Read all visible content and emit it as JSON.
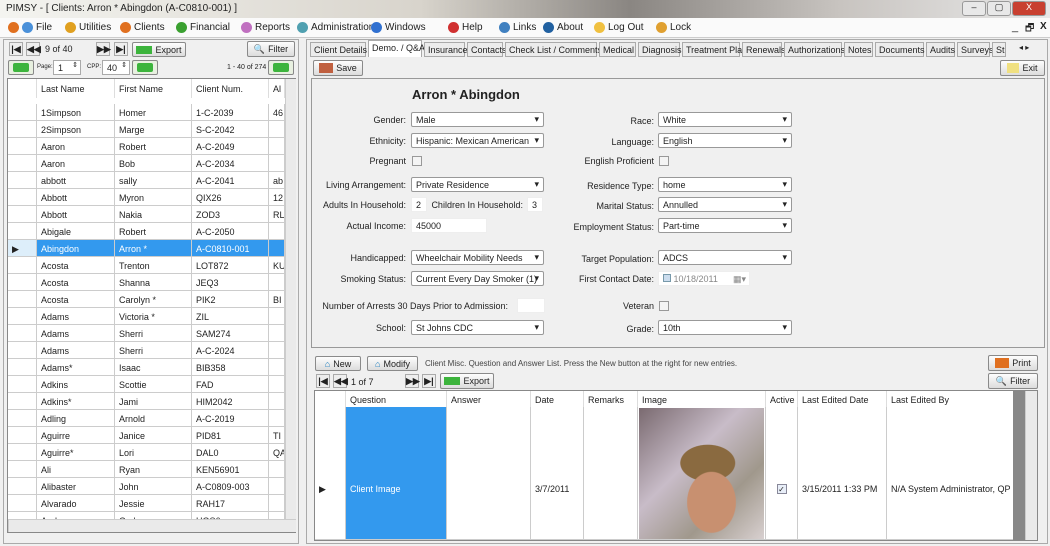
{
  "window": {
    "title": "PIMSY - [ Clients:  Arron * Abingdon (A-C0810-001) ]",
    "min": "–",
    "max": "▢",
    "close": "X"
  },
  "menu": [
    {
      "label": "File",
      "color": "#4a90d9"
    },
    {
      "label": "Utilities",
      "color": "#e0a020"
    },
    {
      "label": "Clients",
      "color": "#e07020"
    },
    {
      "label": "Financial",
      "color": "#3aa030"
    },
    {
      "label": "Reports",
      "color": "#c070c0"
    },
    {
      "label": "Administration",
      "color": "#50a0b0"
    },
    {
      "label": "Windows",
      "color": "#3070d0"
    },
    {
      "label": "Help",
      "color": "#d03030"
    },
    {
      "label": "Links",
      "color": "#4080c0"
    },
    {
      "label": "About",
      "color": "#2060a0"
    },
    {
      "label": "Log Out",
      "color": "#f0c040"
    },
    {
      "label": "Lock",
      "color": "#e0a030"
    }
  ],
  "menu_right": {
    "min": "_",
    "restore": "🗗",
    "close": "X"
  },
  "list": {
    "position": "9 of  40",
    "export": "Export",
    "filter": "Filter",
    "page_label": "Page:",
    "page": "1",
    "cpp_label": "CPP:",
    "cpp": "40",
    "range": "1 - 40 of 274",
    "columns": [
      "Last Name",
      "First Name",
      "Client Num.",
      "Al"
    ],
    "rows": [
      [
        "1Simpson",
        "Homer",
        "1-C-2039",
        "46"
      ],
      [
        "2Simpson",
        "Marge",
        "S-C-2042",
        ""
      ],
      [
        "Aaron",
        "Robert",
        "A-C-2049",
        ""
      ],
      [
        "Aaron",
        "Bob",
        "A-C-2034",
        ""
      ],
      [
        "abbott",
        "sally",
        "A-C-2041",
        "ab"
      ],
      [
        "Abbott",
        "Myron",
        "QIX26",
        "12"
      ],
      [
        "Abbott",
        "Nakia",
        "ZOD3",
        "RL"
      ],
      [
        "Abigale",
        "Robert",
        "A-C-2050",
        ""
      ],
      [
        "Abingdon",
        "Arron *",
        "A-C0810-001",
        ""
      ],
      [
        "Acosta",
        "Trenton",
        "LOT872",
        "KU"
      ],
      [
        "Acosta",
        "Shanna",
        "JEQ3",
        ""
      ],
      [
        "Acosta",
        "Carolyn *",
        "PIK2",
        "BI"
      ],
      [
        "Adams",
        "Victoria *",
        "ZIL",
        ""
      ],
      [
        "Adams",
        "Sherri",
        "SAM274",
        ""
      ],
      [
        "Adams",
        "Sherri",
        "A-C-2024",
        ""
      ],
      [
        "Adams*",
        "Isaac",
        "BIB358",
        ""
      ],
      [
        "Adkins",
        "Scottie",
        "FAD",
        ""
      ],
      [
        "Adkins*",
        "Jami",
        "HIM2042",
        ""
      ],
      [
        "Adling",
        "Arnold",
        "A-C-2019",
        ""
      ],
      [
        "Aguirre",
        "Janice",
        "PID81",
        "TI"
      ],
      [
        "Aguirre*",
        "Lori",
        "DAL0",
        "QA"
      ],
      [
        "Ali",
        "Ryan",
        "KEN56901",
        ""
      ],
      [
        "Alibaster",
        "John",
        "A-C0809-003",
        ""
      ],
      [
        "Alvarado",
        "Jessie",
        "RAH17",
        ""
      ],
      [
        "Andersen",
        "Cody",
        "HOS6",
        ""
      ]
    ],
    "selected_index": 8
  },
  "tabs": [
    "Client Details",
    "Demo. / Q&A",
    "Insurance",
    "Contacts",
    "Check List / Comments",
    "Medical",
    "Diagnosis",
    "Treatment Plan",
    "Renewals",
    "Authorizations",
    "Notes",
    "Documents",
    "Audits",
    "Surveys",
    "St"
  ],
  "active_tab": 1,
  "toolbar": {
    "save": "Save",
    "exit": "Exit"
  },
  "form": {
    "client_name": "Arron * Abingdon",
    "gender_label": "Gender:",
    "gender": "Male",
    "ethnicity_label": "Ethnicity:",
    "ethnicity": "Hispanic:  Mexican American",
    "pregnant_label": "Pregnant",
    "pregnant": false,
    "living_label": "Living Arrangement:",
    "living": "Private Residence",
    "adults_label": "Adults In Household:",
    "adults": "2",
    "children_label": "Children In Household:",
    "children": "3",
    "income_label": "Actual Income:",
    "income": "45000",
    "handicapped_label": "Handicapped:",
    "handicapped": "Wheelchair Mobility Needs",
    "smoking_label": "Smoking Status:",
    "smoking": "Current Every Day Smoker (1)",
    "arrests_label": "Number of Arrests 30 Days Prior to Admission:",
    "arrests": "",
    "school_label": "School:",
    "school": "St Johns CDC",
    "race_label": "Race:",
    "race": "White",
    "language_label": "Language:",
    "language": "English",
    "proficient_label": "English Proficient",
    "proficient": false,
    "residence_label": "Residence Type:",
    "residence": "home",
    "marital_label": "Marital Status:",
    "marital": "Annulled",
    "employment_label": "Employment Status:",
    "employment": "Part-time",
    "target_label": "Target Population:",
    "target": "ADCS",
    "contact_label": "First Contact Date:",
    "contact": "10/18/2011",
    "veteran_label": "Veteran",
    "veteran": false,
    "grade_label": "Grade:",
    "grade": "10th"
  },
  "qa": {
    "new": "New",
    "modify": "Modify",
    "hint": "Client Misc. Question and Answer List.  Press the New button at the right for new entries.",
    "print": "Print",
    "filter": "Filter",
    "position": "1 of  7",
    "export": "Export",
    "columns": [
      "Question",
      "Answer",
      "Date",
      "Remarks",
      "Image",
      "Active",
      "Last Edited Date",
      "Last Edited By"
    ],
    "row": {
      "question": "Client Image",
      "answer": "",
      "date": "3/7/2011",
      "remarks": "",
      "active": true,
      "active_mark": "✓",
      "edited_date": "3/15/2011 1:33 PM",
      "edited_by": "N/A System Administrator, QP"
    }
  },
  "colors": {
    "selection": "#3399ee",
    "accent_green": "#3cb43c"
  }
}
